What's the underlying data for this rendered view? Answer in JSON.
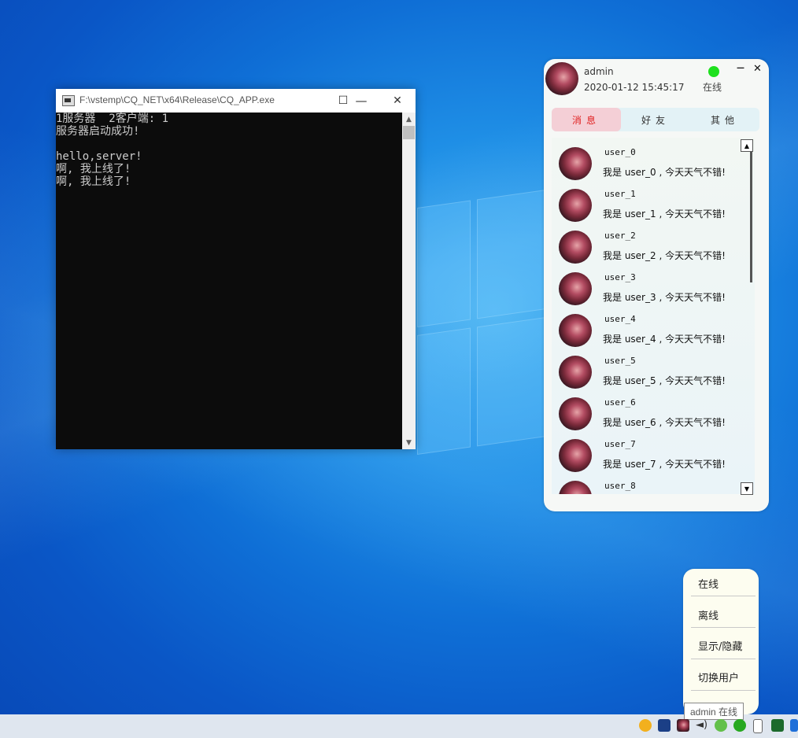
{
  "console": {
    "title": "F:\\vstemp\\CQ_NET\\x64\\Release\\CQ_APP.exe",
    "minimize_label": "—",
    "maximize_label": "☐",
    "close_label": "✕",
    "lines": [
      "1服务器  2客户端: 1",
      "服务器启动成功!",
      "",
      "hello,server!",
      "啊, 我上线了!",
      "啊, 我上线了!"
    ]
  },
  "chat": {
    "username": "admin",
    "datetime": "2020-01-12 15:45:17",
    "status": "在线",
    "status_color": "#1ee01e",
    "minimize_label": "—",
    "close_label": "✕",
    "tabs": [
      {
        "label": "消息",
        "active": true
      },
      {
        "label": "好友",
        "active": false
      },
      {
        "label": "其他",
        "active": false
      }
    ],
    "messages": [
      {
        "name": "user_0",
        "text": "我是 user_0 , 今天天气不错!"
      },
      {
        "name": "user_1",
        "text": "我是 user_1 , 今天天气不错!"
      },
      {
        "name": "user_2",
        "text": "我是 user_2 , 今天天气不错!"
      },
      {
        "name": "user_3",
        "text": "我是 user_3 , 今天天气不错!"
      },
      {
        "name": "user_4",
        "text": "我是 user_4 , 今天天气不错!"
      },
      {
        "name": "user_5",
        "text": "我是 user_5 , 今天天气不错!"
      },
      {
        "name": "user_6",
        "text": "我是 user_6 , 今天天气不错!"
      },
      {
        "name": "user_7",
        "text": "我是 user_7 , 今天天气不错!"
      },
      {
        "name": "user_8",
        "text": ""
      }
    ]
  },
  "tray_menu": {
    "items": [
      "在线",
      "离线",
      "显示/隐藏",
      "切换用户"
    ]
  },
  "tooltip": "admin 在线",
  "tray_icons": [
    "app-c-icon",
    "tq-icon",
    "avatar-app-icon",
    "speaker-icon",
    "wechat-icon",
    "green-app-icon",
    "usb-icon",
    "security-shield-icon",
    "bluetooth-icon"
  ]
}
